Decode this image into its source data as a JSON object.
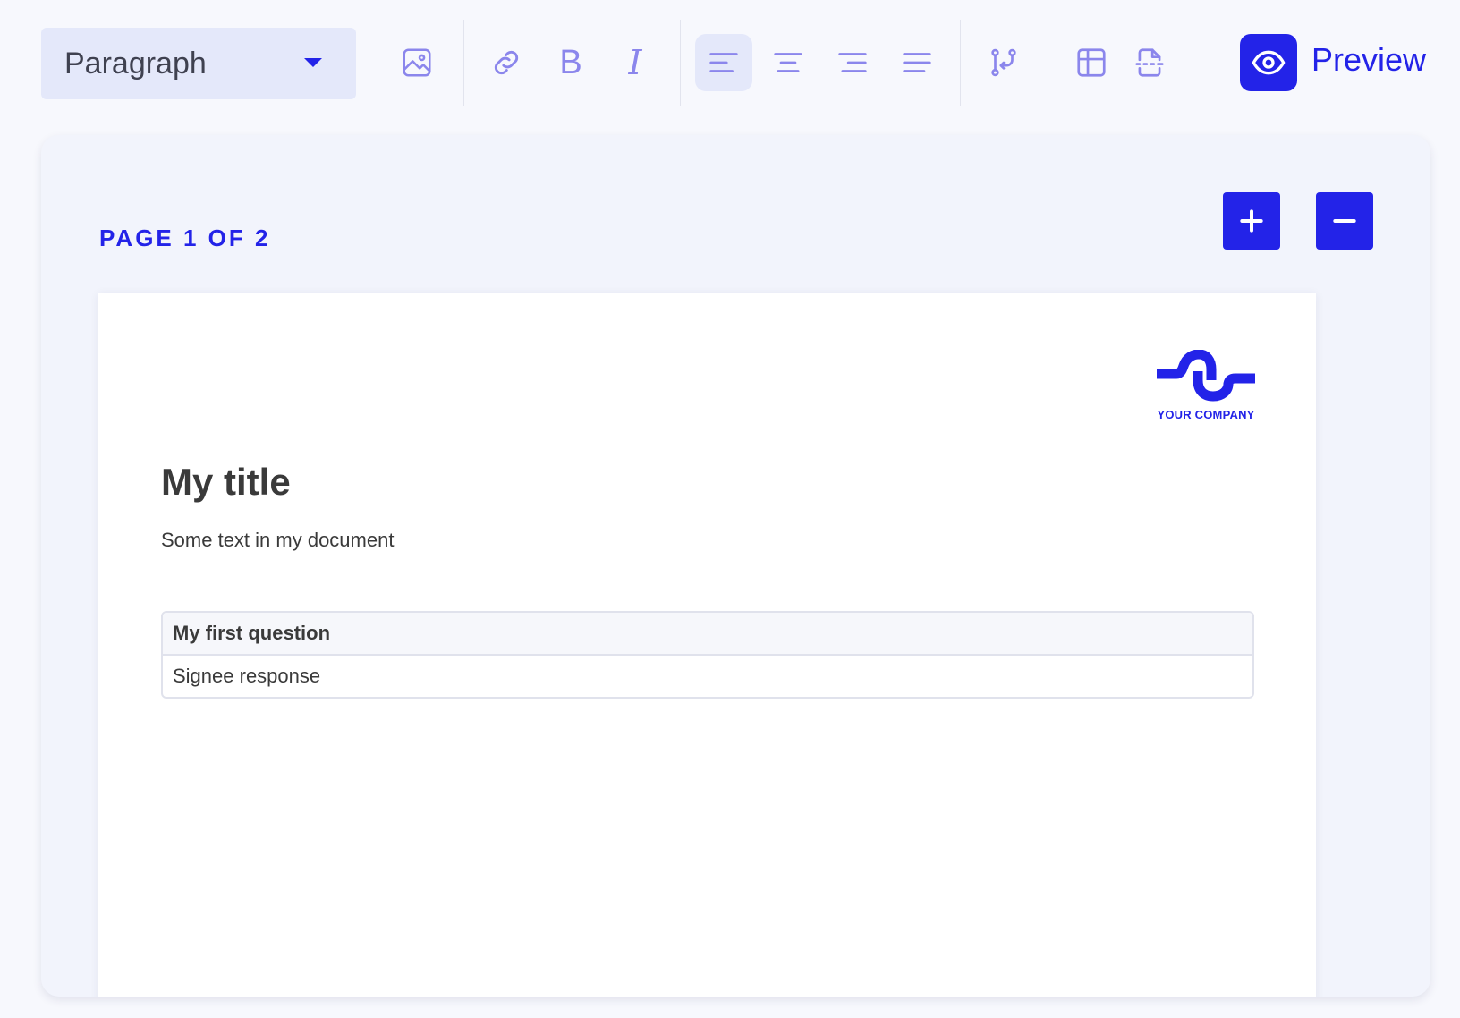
{
  "toolbar": {
    "block_type": "Paragraph",
    "buttons": [
      {
        "name": "image-icon",
        "tooltip_icon": "image"
      },
      {
        "name": "link-icon",
        "tooltip_icon": "link"
      },
      {
        "name": "bold-icon",
        "glyph": "B"
      },
      {
        "name": "italic-icon",
        "glyph": "I"
      },
      {
        "name": "align-left-icon",
        "active": true
      },
      {
        "name": "align-center-icon"
      },
      {
        "name": "align-right-icon"
      },
      {
        "name": "align-justify-icon"
      },
      {
        "name": "branch-icon"
      },
      {
        "name": "table-icon"
      },
      {
        "name": "page-break-icon"
      }
    ],
    "preview_label": "Preview"
  },
  "editor": {
    "page_indicator": "PAGE 1 OF 2",
    "add_page_icon": "plus-icon",
    "remove_page_icon": "minus-icon"
  },
  "document": {
    "logo_text": "YOUR COMPANY",
    "title": "My title",
    "text": "Some text in my document",
    "question": {
      "label": "My first question",
      "response": "Signee response"
    }
  },
  "colors": {
    "accent": "#2323e8",
    "icon_muted": "#8b86ec",
    "active_bg": "#e4e8fa",
    "panel_bg": "#f2f4fc"
  }
}
